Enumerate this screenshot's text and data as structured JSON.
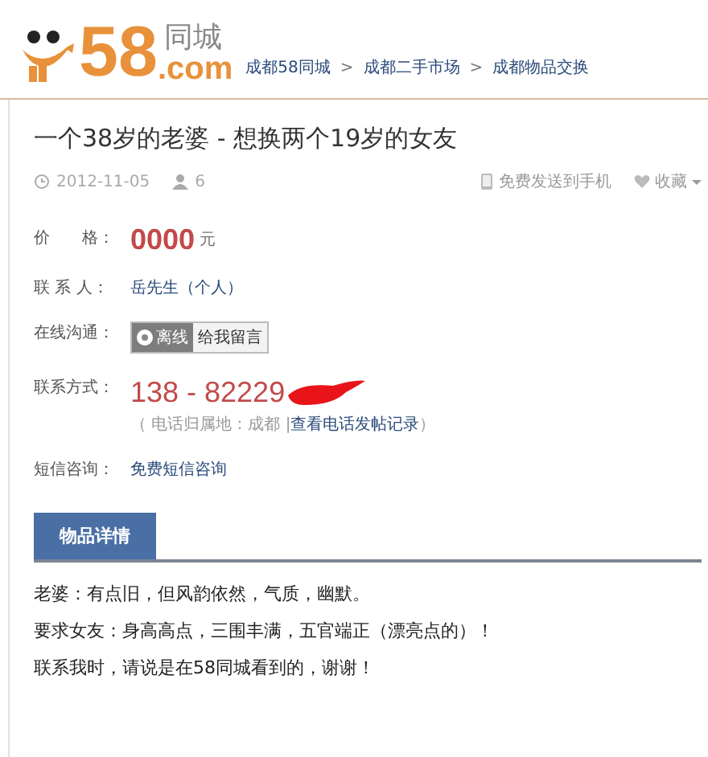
{
  "header": {
    "logo": {
      "number": "58",
      "domain": ".com",
      "brand": "同城"
    },
    "breadcrumbs": [
      {
        "label": "成都58同城"
      },
      {
        "label": "成都二手市场"
      },
      {
        "label": "成都物品交换"
      }
    ],
    "separator": ">"
  },
  "post": {
    "title": "一个38岁的老婆 - 想换两个19岁的女友",
    "date": "2012-11-05",
    "views": "6",
    "actions": [
      {
        "kind": "phone",
        "label": "免费发送到手机"
      },
      {
        "kind": "favorite",
        "label": "收藏"
      }
    ]
  },
  "fields": [
    {
      "kind": "price",
      "label": "价　　格：",
      "value": "0000",
      "unit": "元"
    },
    {
      "kind": "contact",
      "label": "联 系 人：",
      "value": "岳先生（个人）"
    },
    {
      "kind": "chat",
      "label": "在线沟通：",
      "status": "离线",
      "button": "给我留言"
    },
    {
      "kind": "phone",
      "label": "联系方式：",
      "value": "138 - 82229",
      "note_prefix": "（ 电话归属地：成都 |",
      "note_link": "查看电话发帖记录",
      "note_suffix": "）"
    },
    {
      "kind": "sms",
      "label": "短信咨询：",
      "value": "免费短信咨询"
    }
  ],
  "details": {
    "tab": "物品详情",
    "lines": [
      "老婆：有点旧，但风韵依然，气质，幽默。",
      "要求女友：身高高点，三围丰满，五官端正（漂亮点的）！",
      "联系我时，请说是在58同城看到的，谢谢！"
    ]
  }
}
